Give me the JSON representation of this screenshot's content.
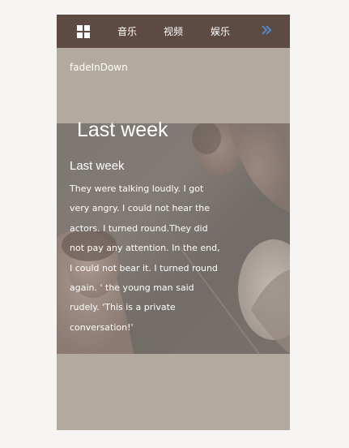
{
  "navbar": {
    "menu_icon": "grid-icon",
    "items": [
      {
        "label": "音乐"
      },
      {
        "label": "视频"
      },
      {
        "label": "娱乐"
      }
    ],
    "more_icon": "double-chevron-right-icon",
    "more_color": "#4e8fd6"
  },
  "animation_label": "fadeInDown",
  "hero": {
    "title": "Last week"
  },
  "article": {
    "title": "Last week",
    "body": "They were talking loudly. I got very angry. I could not hear the actors. I turned round.They did not pay any attention. In the end, I could not bear it. I turned round again. ' the young man said rudely. 'This is a private conversation!'"
  },
  "colors": {
    "navbar_bg": "#5d4a43",
    "panel_bg": "#b3aa9f",
    "page_bg": "#f6f5f4"
  }
}
